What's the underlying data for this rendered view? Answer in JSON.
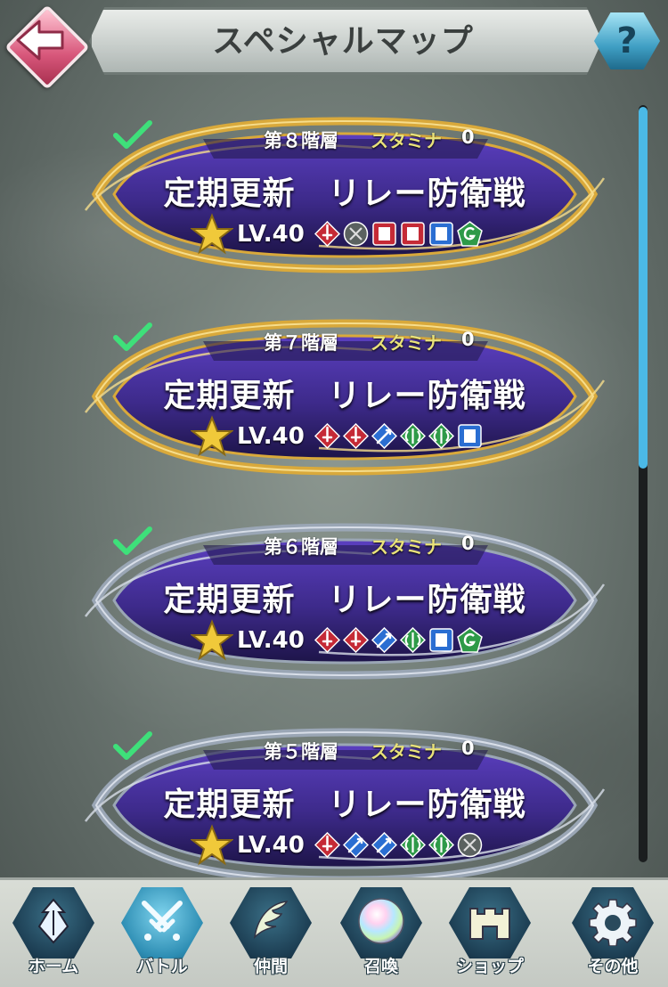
{
  "header": {
    "title": "スペシャルマップ",
    "help_label": "?"
  },
  "colors": {
    "gold_frame": "#d9a93b",
    "silver_frame": "#9aa6b5",
    "card_fill": "#3d2a8a",
    "accent_blue": "#4bb9e6",
    "stamina_yellow": "#e9e27a"
  },
  "stages": [
    {
      "floor": "第８階層",
      "stamina_label": "スタミナ",
      "stamina_value": "0",
      "name": "定期更新　リレー防衛戦",
      "level": "LV.40",
      "frame": "gold",
      "cleared": true,
      "units": [
        "red-sword",
        "gray-bow",
        "red-tome",
        "red-tome",
        "blue-tome",
        "green-dragon"
      ]
    },
    {
      "floor": "第７階層",
      "stamina_label": "スタミナ",
      "stamina_value": "0",
      "name": "定期更新　リレー防衛戦",
      "level": "LV.40",
      "frame": "gold",
      "cleared": true,
      "units": [
        "red-sword",
        "red-sword",
        "blue-lance",
        "green-axe",
        "green-axe",
        "blue-tome"
      ]
    },
    {
      "floor": "第６階層",
      "stamina_label": "スタミナ",
      "stamina_value": "0",
      "name": "定期更新　リレー防衛戦",
      "level": "LV.40",
      "frame": "silver",
      "cleared": true,
      "units": [
        "red-sword",
        "red-sword",
        "blue-lance",
        "green-axe",
        "blue-tome",
        "green-dragon"
      ]
    },
    {
      "floor": "第５階層",
      "stamina_label": "スタミナ",
      "stamina_value": "0",
      "name": "定期更新　リレー防衛戦",
      "level": "LV.40",
      "frame": "silver",
      "cleared": true,
      "units": [
        "red-sword",
        "blue-lance",
        "blue-lance",
        "green-axe",
        "green-axe",
        "gray-bow"
      ]
    }
  ],
  "nav": [
    {
      "label": "ホーム",
      "icon": "home-crest-icon",
      "active": false
    },
    {
      "label": "バトル",
      "icon": "crossed-swords-icon",
      "active": true
    },
    {
      "label": "仲間",
      "icon": "wing-icon",
      "active": false
    },
    {
      "label": "召喚",
      "icon": "orb-icon",
      "active": false
    },
    {
      "label": "ショップ",
      "icon": "castle-icon",
      "active": false
    },
    {
      "label": "その他",
      "icon": "gear-icon",
      "active": false
    }
  ]
}
